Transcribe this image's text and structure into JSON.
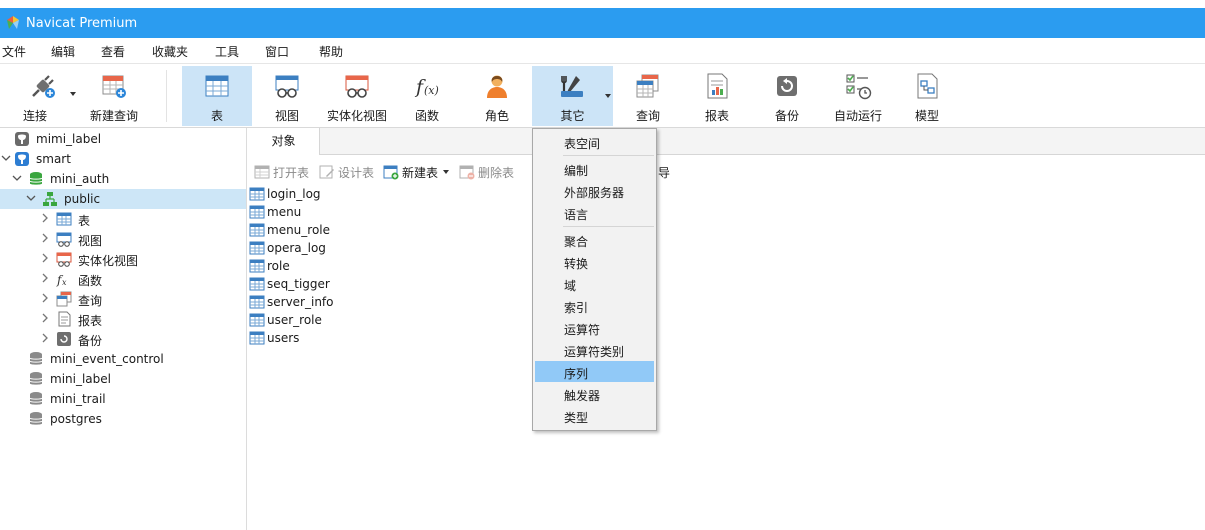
{
  "window": {
    "title": "Navicat Premium"
  },
  "menu": [
    "文件",
    "编辑",
    "查看",
    "收藏夹",
    "工具",
    "窗口",
    "帮助"
  ],
  "toolbar": {
    "connect": "连接",
    "new_query": "新建查询",
    "table": "表",
    "view": "视图",
    "mat_view": "实体化视图",
    "function": "函数",
    "role": "角色",
    "other": "其它",
    "query": "查询",
    "report": "报表",
    "backup": "备份",
    "auto_run": "自动运行",
    "model": "模型"
  },
  "tree": {
    "items": [
      "mimi_label",
      "smart",
      "mini_auth",
      "public",
      "表",
      "视图",
      "实体化视图",
      "函数",
      "查询",
      "报表",
      "备份",
      "mini_event_control",
      "mini_label",
      "mini_trail",
      "postgres"
    ]
  },
  "tab": {
    "objects": "对象"
  },
  "object_toolbar": {
    "open_table": "打开表",
    "design_table": "设计表",
    "new_table": "新建表",
    "delete_table": "删除表",
    "export_partial": "导"
  },
  "objects": [
    "login_log",
    "menu",
    "menu_role",
    "opera_log",
    "role",
    "seq_tigger",
    "server_info",
    "user_role",
    "users"
  ],
  "dropdown": {
    "items": [
      "表空间",
      "编制",
      "外部服务器",
      "语言",
      "聚合",
      "转换",
      "域",
      "索引",
      "运算符",
      "运算符类别",
      "序列",
      "触发器",
      "类型"
    ],
    "highlighted": "序列"
  },
  "colors": {
    "titlebar": "#2b9cf0",
    "selection": "#cde6f7",
    "menu_highlight": "#91c9f7"
  }
}
